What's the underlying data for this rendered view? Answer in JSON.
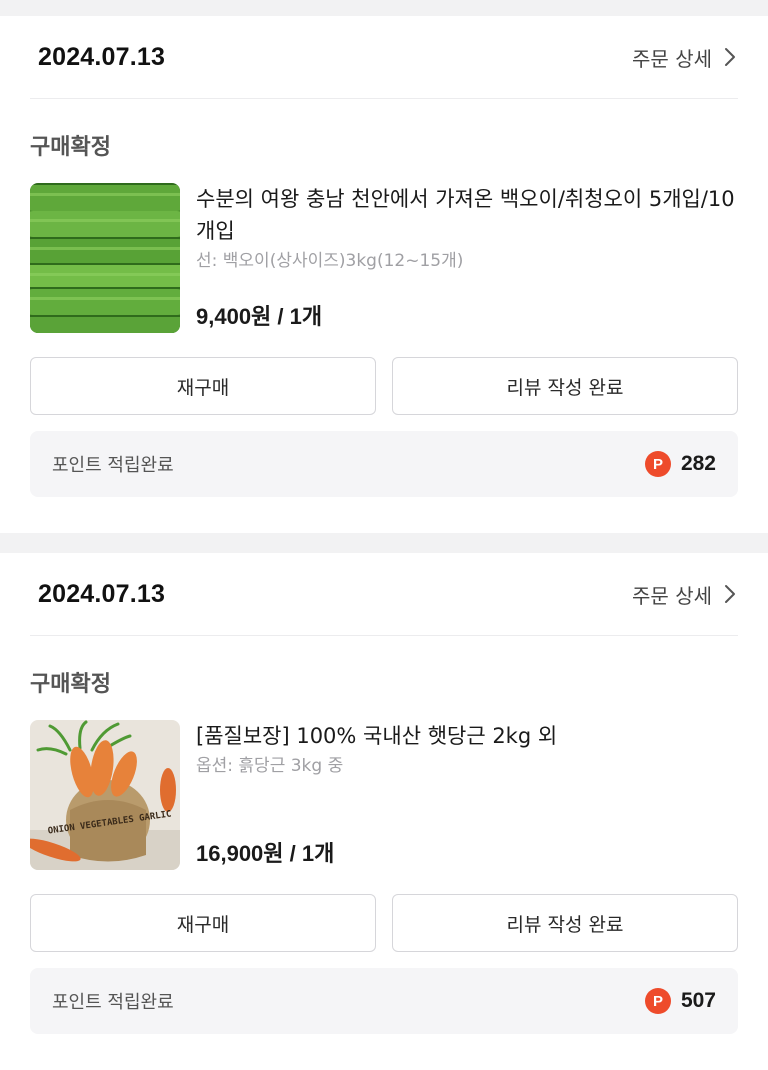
{
  "orders": [
    {
      "date": "2024.07.13",
      "detail_label": "주문 상세",
      "status": "구매확정",
      "product_name": "수분의 여왕 충남 천안에서 가져온 백오이/취청오이 5개입/10개입",
      "option": "선: 백오이(상사이즈)3kg(12~15개)",
      "price": "9,400원 / 1개",
      "thumb_icon": "cucumber-product-image",
      "rebuy_label": "재구매",
      "review_label": "리뷰 작성 완료",
      "points_label": "포인트 적립완료",
      "points_badge": "P",
      "points_value": "282"
    },
    {
      "date": "2024.07.13",
      "detail_label": "주문 상세",
      "status": "구매확정",
      "product_name": "[품질보장] 100% 국내산 햇당근 2kg 외",
      "option": "옵션: 흙당근 3kg 중",
      "price": "16,900원 / 1개",
      "thumb_icon": "carrot-product-image",
      "thumb_text": "ONION VEGETABLES GARLIC",
      "rebuy_label": "재구매",
      "review_label": "리뷰 작성 완료",
      "points_label": "포인트 적립완료",
      "points_badge": "P",
      "points_value": "507"
    }
  ],
  "colors": {
    "accent_badge": "#ee4b2b",
    "background": "#f2f2f3",
    "card": "#ffffff"
  }
}
